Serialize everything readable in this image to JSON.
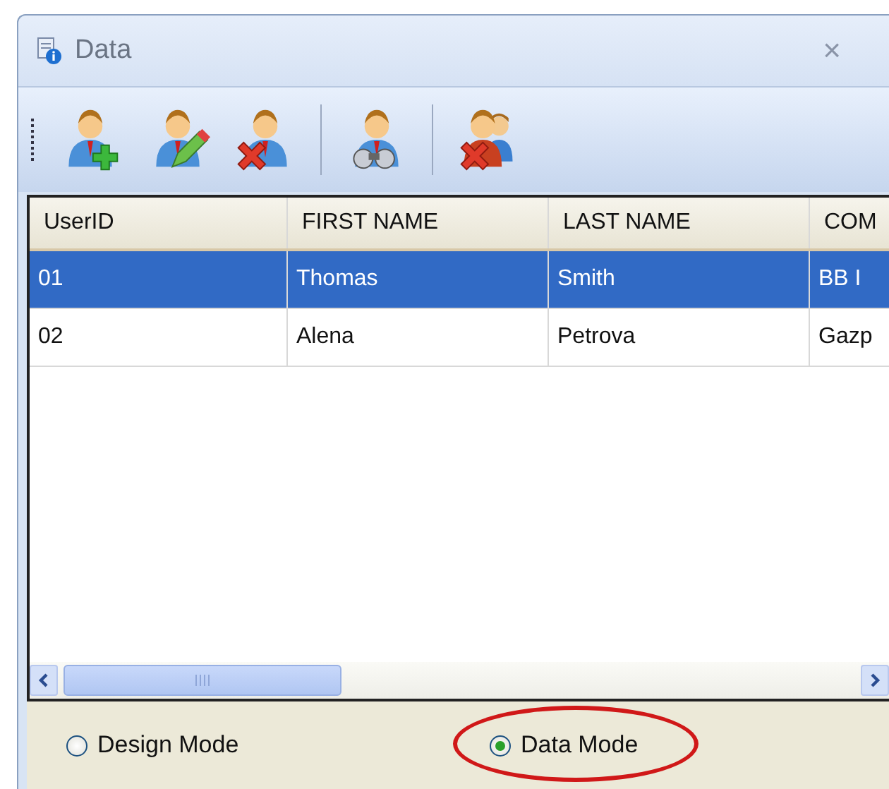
{
  "window": {
    "title": "Data",
    "close": "×"
  },
  "toolbar": {
    "buttons": [
      {
        "kind": "add"
      },
      {
        "kind": "edit"
      },
      {
        "kind": "delete"
      },
      {
        "kind": "search"
      },
      {
        "kind": "delete-group"
      }
    ]
  },
  "table": {
    "columns": [
      "UserID",
      "FIRST NAME",
      "LAST NAME",
      "COM"
    ],
    "rows": [
      {
        "cells": [
          "01",
          "Thomas",
          "Smith",
          "BB I"
        ],
        "selected": true
      },
      {
        "cells": [
          "02",
          "Alena",
          "Petrova",
          "Gazp"
        ],
        "selected": false
      }
    ]
  },
  "modes": [
    {
      "label": "Design Mode",
      "selected": false,
      "highlighted": false
    },
    {
      "label": "Data Mode",
      "selected": true,
      "highlighted": true
    }
  ]
}
